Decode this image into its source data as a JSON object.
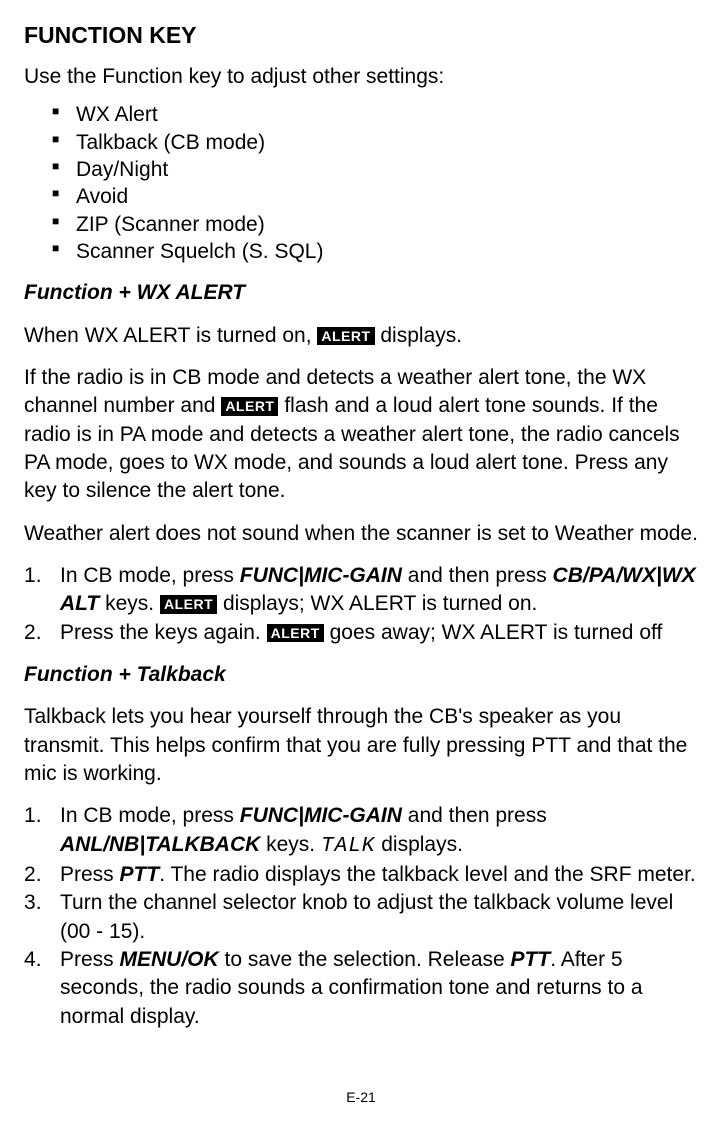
{
  "title": "FUNCTION KEY",
  "intro": "Use the Function key to adjust other settings:",
  "settings": [
    "WX Alert",
    "Talkback (CB mode)",
    "Day/Night",
    "Avoid",
    "ZIP (Scanner mode)",
    "Scanner Squelch (S. SQL)"
  ],
  "alert_label": "ALERT",
  "section_wx": {
    "heading": "Function + WX ALERT",
    "p1_pre": "When WX ALERT is turned on, ",
    "p1_post": " displays.",
    "p2_pre": "If the radio is in CB mode and detects a weather alert tone, the WX channel number and  ",
    "p2_post": " flash and a loud alert tone sounds. If the radio is in PA mode and detects a weather alert tone, the radio cancels PA mode, goes to WX mode, and sounds a loud alert tone. Press any key to silence the alert tone.",
    "p3": "Weather alert does not sound when the scanner is set to Weather mode.",
    "step1_a": "In CB mode, press ",
    "step1_key1": "FUNC|MIC-GAIN",
    "step1_b": " and then press ",
    "step1_key2": "CB/PA/WX|WX ALT",
    "step1_c": " keys. ",
    "step1_d": " displays; WX ALERT is turned on.",
    "step2_a": "Press the keys again. ",
    "step2_b": " goes away; WX ALERT is turned off"
  },
  "section_tb": {
    "heading": "Function + Talkback",
    "p1": "Talkback lets you hear yourself through the CB's speaker as you transmit. This helps confirm that you are fully pressing PTT and that the mic is working.",
    "step1_a": "In CB mode, press ",
    "step1_key1": "FUNC|MIC-GAIN",
    "step1_b": " and then press ",
    "step1_key2": "ANL/NB|TALKBACK",
    "step1_c": " keys. ",
    "step1_disp": "TALK",
    "step1_d": " displays.",
    "step2_a": "Press ",
    "step2_key": "PTT",
    "step2_b": ". The radio displays the talkback level and the SRF meter.",
    "step3": "Turn the channel selector knob to adjust the talkback volume level (00 - 15).",
    "step4_a": "Press ",
    "step4_key1": "MENU/OK",
    "step4_b": " to save the selection. Release ",
    "step4_key2": "PTT",
    "step4_c": ". After 5 seconds, the radio sounds a confirmation tone and returns to a normal display."
  },
  "page_number": "E-21"
}
